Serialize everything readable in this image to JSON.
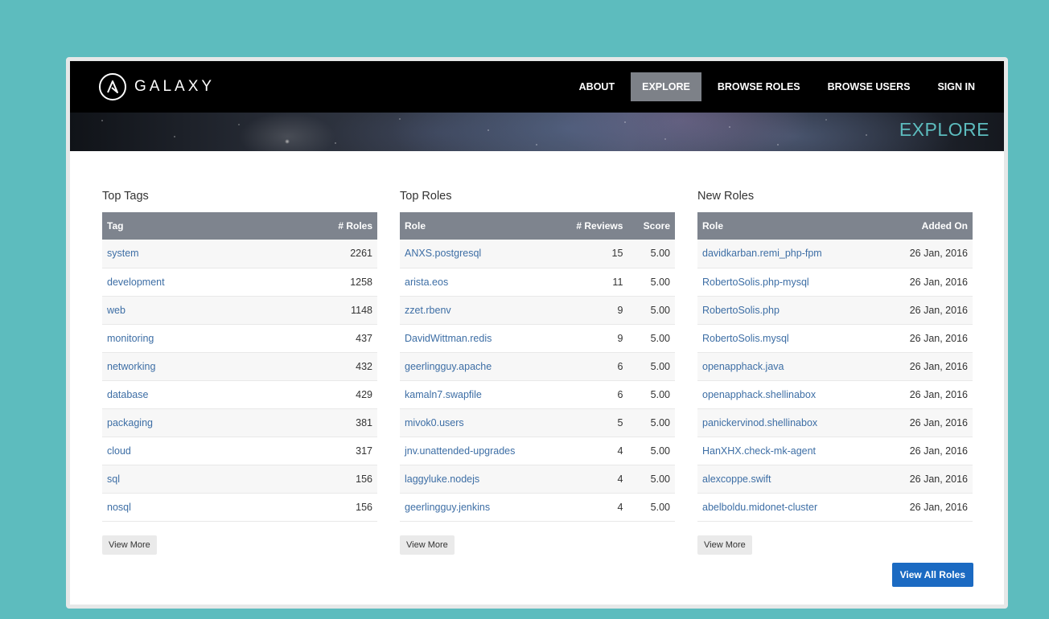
{
  "brand": {
    "name": "GALAXY"
  },
  "nav": [
    {
      "label": "ABOUT",
      "active": false
    },
    {
      "label": "EXPLORE",
      "active": true
    },
    {
      "label": "BROWSE ROLES",
      "active": false
    },
    {
      "label": "BROWSE USERS",
      "active": false
    },
    {
      "label": "SIGN IN",
      "active": false
    }
  ],
  "banner": {
    "title": "EXPLORE"
  },
  "top_tags": {
    "title": "Top Tags",
    "headers": [
      "Tag",
      "# Roles"
    ],
    "rows": [
      {
        "name": "system",
        "count": "2261"
      },
      {
        "name": "development",
        "count": "1258"
      },
      {
        "name": "web",
        "count": "1148"
      },
      {
        "name": "monitoring",
        "count": "437"
      },
      {
        "name": "networking",
        "count": "432"
      },
      {
        "name": "database",
        "count": "429"
      },
      {
        "name": "packaging",
        "count": "381"
      },
      {
        "name": "cloud",
        "count": "317"
      },
      {
        "name": "sql",
        "count": "156"
      },
      {
        "name": "nosql",
        "count": "156"
      }
    ],
    "view_more": "View More"
  },
  "top_roles": {
    "title": "Top Roles",
    "headers": [
      "Role",
      "# Reviews",
      "Score"
    ],
    "rows": [
      {
        "name": "ANXS.postgresql",
        "reviews": "15",
        "score": "5.00"
      },
      {
        "name": "arista.eos",
        "reviews": "11",
        "score": "5.00"
      },
      {
        "name": "zzet.rbenv",
        "reviews": "9",
        "score": "5.00"
      },
      {
        "name": "DavidWittman.redis",
        "reviews": "9",
        "score": "5.00"
      },
      {
        "name": "geerlingguy.apache",
        "reviews": "6",
        "score": "5.00"
      },
      {
        "name": "kamaln7.swapfile",
        "reviews": "6",
        "score": "5.00"
      },
      {
        "name": "mivok0.users",
        "reviews": "5",
        "score": "5.00"
      },
      {
        "name": "jnv.unattended-upgrades",
        "reviews": "4",
        "score": "5.00"
      },
      {
        "name": "laggyluke.nodejs",
        "reviews": "4",
        "score": "5.00"
      },
      {
        "name": "geerlingguy.jenkins",
        "reviews": "4",
        "score": "5.00"
      }
    ],
    "view_more": "View More"
  },
  "new_roles": {
    "title": "New Roles",
    "headers": [
      "Role",
      "Added On"
    ],
    "rows": [
      {
        "name": "davidkarban.remi_php-fpm",
        "date": "26 Jan, 2016"
      },
      {
        "name": "RobertoSolis.php-mysql",
        "date": "26 Jan, 2016"
      },
      {
        "name": "RobertoSolis.php",
        "date": "26 Jan, 2016"
      },
      {
        "name": "RobertoSolis.mysql",
        "date": "26 Jan, 2016"
      },
      {
        "name": "openapphack.java",
        "date": "26 Jan, 2016"
      },
      {
        "name": "openapphack.shellinabox",
        "date": "26 Jan, 2016"
      },
      {
        "name": "panickervinod.shellinabox",
        "date": "26 Jan, 2016"
      },
      {
        "name": "HanXHX.check-mk-agent",
        "date": "26 Jan, 2016"
      },
      {
        "name": "alexcoppe.swift",
        "date": "26 Jan, 2016"
      },
      {
        "name": "abelboldu.midonet-cluster",
        "date": "26 Jan, 2016"
      }
    ],
    "view_more": "View More"
  },
  "view_all": "View All Roles",
  "colors": {
    "background": "#5dbcbe",
    "accent": "#5dbcbe",
    "link": "#3d6ea5",
    "header_bg": "#7e848e",
    "primary_button": "#1b6ac2"
  }
}
